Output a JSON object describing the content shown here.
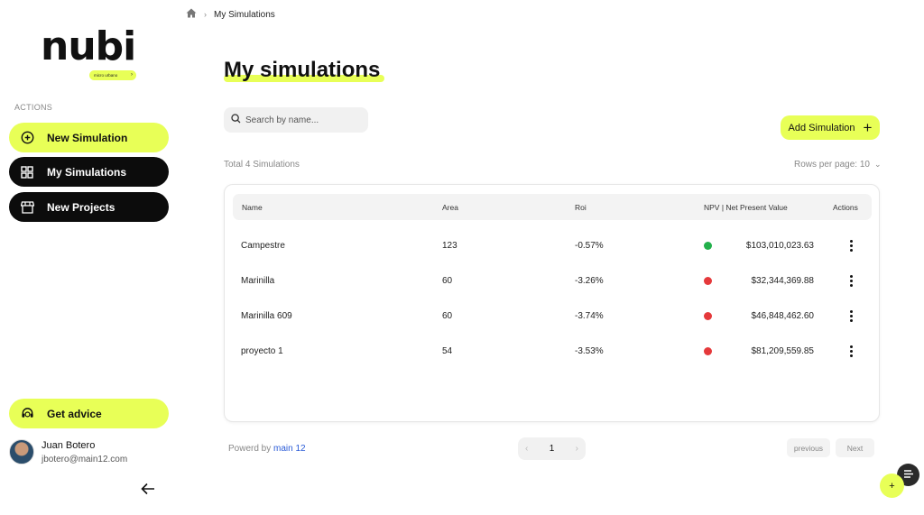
{
  "brand": {
    "logo_text": "nubi",
    "tagline": "micro urbano"
  },
  "breadcrumb": {
    "current": "My Simulations"
  },
  "sidebar": {
    "actions_label": "ACTIONS",
    "items": [
      {
        "label": "New Simulation",
        "icon": "plus-circle-icon",
        "style": "lime"
      },
      {
        "label": "My Simulations",
        "icon": "grid-icon",
        "style": "dark"
      },
      {
        "label": "New Projects",
        "icon": "storefront-icon",
        "style": "dark"
      }
    ],
    "advice_label": "Get advice",
    "user": {
      "name": "Juan Botero",
      "email": "jbotero@main12.com"
    }
  },
  "main": {
    "title": "My simulations",
    "search_placeholder": "Search by name...",
    "add_button_label": "Add Simulation",
    "total_text": "Total 4 Simulations",
    "rows_per_page": "Rows per page: 10",
    "table": {
      "columns": [
        "Name",
        "Area",
        "Roi",
        "NPV | Net Present Value",
        "Actions"
      ],
      "rows": [
        {
          "name": "Campestre",
          "area": "123",
          "roi": "-0.57%",
          "npv": "$103,010,023.63",
          "status": "green"
        },
        {
          "name": "Marinilla",
          "area": "60",
          "roi": "-3.26%",
          "npv": "$32,344,369.88",
          "status": "red"
        },
        {
          "name": "Marinilla 609",
          "area": "60",
          "roi": "-3.74%",
          "npv": "$46,848,462.60",
          "status": "red"
        },
        {
          "name": "proyecto 1",
          "area": "54",
          "roi": "-3.53%",
          "npv": "$81,209,559.85",
          "status": "red"
        }
      ]
    },
    "footer": {
      "powered_prefix": "Powerd by",
      "powered_link": "main 12",
      "page": "1",
      "previous_label": "previous",
      "next_label": "Next"
    }
  },
  "colors": {
    "accent": "#e8ff57",
    "dark": "#0c0c0c",
    "status_green": "#22b04b",
    "status_red": "#e5393b"
  }
}
